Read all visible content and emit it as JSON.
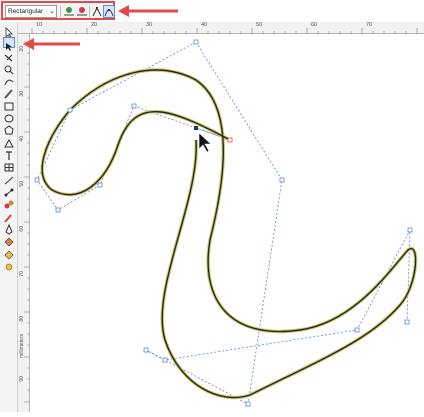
{
  "property_bar": {
    "shape_mode": "Rectangular",
    "buttons": [
      {
        "name": "add-node",
        "icon": "add-node-icon"
      },
      {
        "name": "delete-node",
        "icon": "delete-node-icon"
      },
      {
        "name": "cusp-node",
        "icon": "cusp-node-icon"
      },
      {
        "name": "smooth-node",
        "icon": "smooth-node-icon",
        "active": true
      }
    ]
  },
  "ruler": {
    "corner_label": "%",
    "top_ticks": [
      "10",
      "20",
      "30",
      "40",
      "50",
      "60",
      "70"
    ],
    "left_ticks": [
      "20",
      "30",
      "40",
      "50",
      "60",
      "70",
      "80",
      "90"
    ],
    "unit_label": "millimeters"
  },
  "toolbox": {
    "tools": [
      "pick-tool",
      "shape-tool",
      "crop-tool",
      "zoom-tool",
      "freehand-tool",
      "artistic-media-tool",
      "rectangle-tool",
      "ellipse-tool",
      "polygon-tool",
      "text-tool",
      "table-tool",
      "dimension-tool",
      "connector-tool",
      "interactive-blend-tool",
      "eyedropper-tool",
      "outline-tool",
      "fill-tool",
      "interactive-fill-tool",
      "smart-fill-tool"
    ],
    "active": "shape-tool"
  },
  "colors": {
    "highlight": "#e34b4b",
    "curve": "#2a2a14",
    "curve_glow": "#c8c878",
    "control_line": "#5b87d6"
  }
}
